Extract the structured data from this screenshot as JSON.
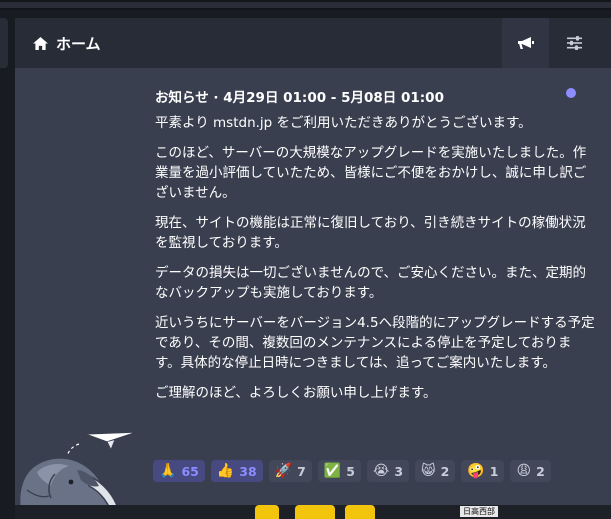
{
  "column": {
    "title": "ホーム",
    "icons": {
      "home": "home-icon",
      "announcements": "megaphone-icon",
      "settings": "sliders-icon"
    }
  },
  "announcement": {
    "meta": "お知らせ · 4月29日 01:00 - 5月08日 01:00",
    "paragraphs": [
      "平素より mstdn.jp をご利用いただきありがとうございます。",
      "このほど、サーバーの大規模なアップグレードを実施いたしました。作業量を過小評価していたため、皆様にご不便をおかけし、誠に申し訳ございません。",
      "現在、サイトの機能は正常に復旧しており、引き続きサイトの稼働状況を監視しております。",
      "データの損失は一切ございませんので、ご安心ください。また、定期的なバックアップも実施しております。",
      "近いうちにサーバーをバージョン4.5へ段階的にアップグレードする予定であり、その間、複数回のメンテナンスによる停止を予定しております。具体的な停止日時につきましては、追ってご案内いたします。",
      "ご理解のほど、よろしくお願い申し上げます。"
    ],
    "reactions": [
      {
        "emoji": "🙏",
        "count": "65",
        "active": true
      },
      {
        "emoji": "👍",
        "count": "38",
        "active": true
      },
      {
        "emoji": "🚀",
        "count": "7",
        "active": false
      },
      {
        "emoji": "✅",
        "count": "5",
        "active": false
      },
      {
        "emoji": "😭",
        "count": "3",
        "active": false
      },
      {
        "emoji": "😸",
        "count": "2",
        "active": false
      },
      {
        "emoji": "🤪",
        "count": "1",
        "active": false
      },
      {
        "emoji": "😩",
        "count": "2",
        "active": false
      }
    ]
  },
  "bottom": {
    "label": "日高西部"
  },
  "colors": {
    "accent": "#8c8dff",
    "header_bg": "#282c37",
    "panel_bg": "#393f4f"
  }
}
